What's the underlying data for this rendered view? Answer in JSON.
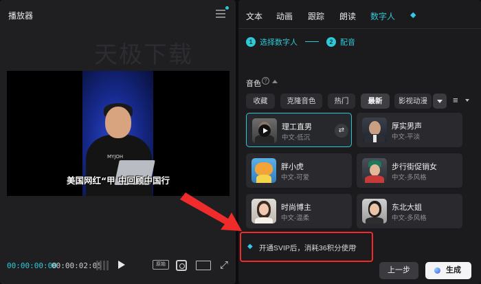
{
  "player": {
    "title": "播放器",
    "watermark": "天极下载",
    "video_caption": "美国网红“甲                    中回顾中国行",
    "shirt_logo": "MYJOH",
    "time_current": "00:00:00:00",
    "time_total": "00:00:02:05",
    "original_label": "原始"
  },
  "tabs": [
    {
      "label": "文本"
    },
    {
      "label": "动画"
    },
    {
      "label": "跟踪"
    },
    {
      "label": "朗读"
    },
    {
      "label": "数字人"
    }
  ],
  "steps": [
    {
      "num": "1",
      "label": "选择数字人"
    },
    {
      "num": "2",
      "label": "配音"
    }
  ],
  "voice": {
    "label": "音色",
    "help": "?",
    "chips": [
      {
        "label": "收藏"
      },
      {
        "label": "克隆音色"
      },
      {
        "label": "热门"
      },
      {
        "label": "最新"
      },
      {
        "label": "影视动漫"
      }
    ],
    "filter_icon": "≡"
  },
  "voices": [
    {
      "name": "理工直男",
      "desc": "中文-低沉"
    },
    {
      "name": "厚实男声",
      "desc": "中文-平淡"
    },
    {
      "name": "胖小虎",
      "desc": "中文-可爱"
    },
    {
      "name": "步行街促销女",
      "desc": "中文-多风格"
    },
    {
      "name": "时尚博主",
      "desc": "中文-温柔"
    },
    {
      "name": "东北大姐",
      "desc": "中文-多风格"
    }
  ],
  "vip": {
    "text": "开通SVIP后，消耗36积分使用",
    "chevron": "›"
  },
  "buttons": {
    "prev": "上一步",
    "generate": "生成"
  },
  "colors": {
    "accent": "#2ec9d6",
    "annotation_red": "#ef2b2b",
    "panel_bg": "#1b1b1e"
  }
}
